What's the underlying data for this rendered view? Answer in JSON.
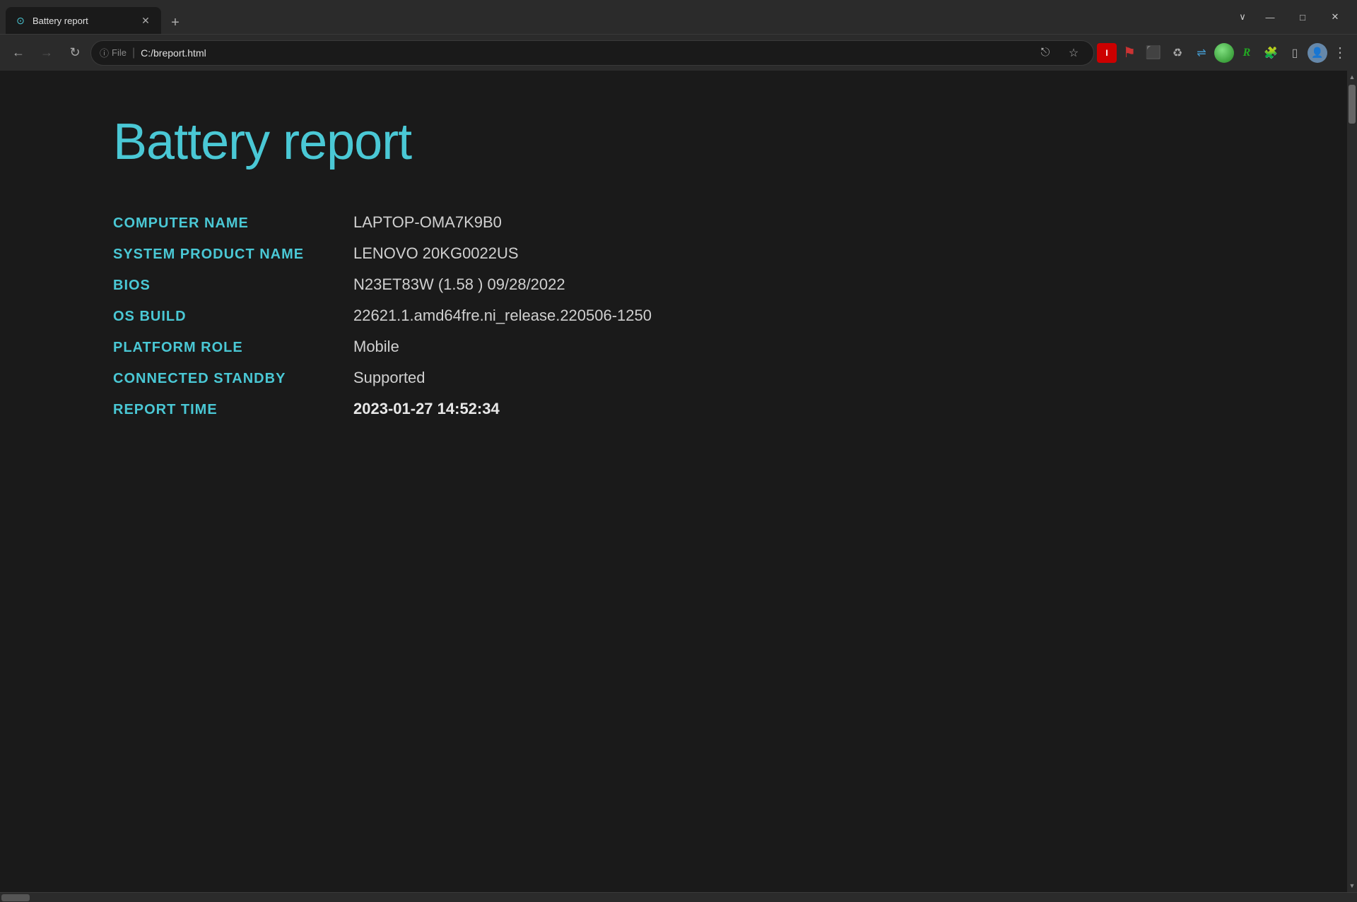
{
  "titlebar": {
    "tab_title": "Battery report",
    "new_tab_label": "+",
    "chevron_label": "∨",
    "minimize_label": "—",
    "maximize_label": "□",
    "close_label": "✕"
  },
  "toolbar": {
    "back_label": "←",
    "forward_label": "→",
    "refresh_label": "↻",
    "info_label": "ⓘ",
    "protocol_label": "File",
    "url": "C:/breport.html",
    "share_label": "⎋",
    "bookmark_label": "☆",
    "extensions_label": "🧩",
    "sidebar_label": "▯",
    "menu_label": "⋮"
  },
  "page": {
    "title": "Battery report",
    "fields": [
      {
        "label": "COMPUTER NAME",
        "value": "LAPTOP-OMA7K9B0",
        "bold": false
      },
      {
        "label": "SYSTEM PRODUCT NAME",
        "value": "LENOVO 20KG0022US",
        "bold": false
      },
      {
        "label": "BIOS",
        "value": "N23ET83W (1.58 ) 09/28/2022",
        "bold": false
      },
      {
        "label": "OS BUILD",
        "value": "22621.1.amd64fre.ni_release.220506-1250",
        "bold": false
      },
      {
        "label": "PLATFORM ROLE",
        "value": "Mobile",
        "bold": false
      },
      {
        "label": "CONNECTED STANDBY",
        "value": "Supported",
        "bold": false
      },
      {
        "label": "REPORT TIME",
        "value": "2023-01-27  14:52:34",
        "bold": true
      }
    ]
  }
}
